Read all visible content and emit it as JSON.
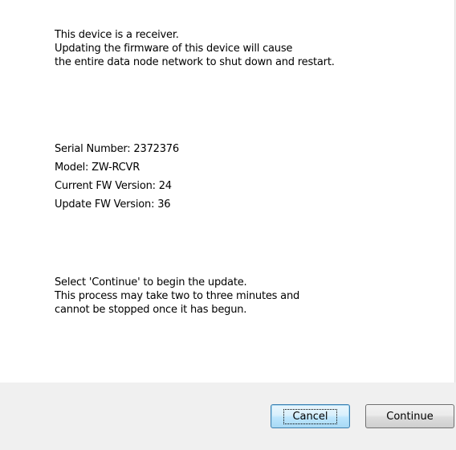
{
  "message": {
    "warning_lines": [
      "This device is a receiver.",
      "Updating the firmware of this device will cause",
      "the entire data node network to shut down and restart."
    ],
    "device_info": [
      "Serial Number: 2372376",
      "Model: ZW-RCVR",
      "Current FW Version: 24",
      "Update FW Version: 36"
    ],
    "instruction_lines": [
      "Select 'Continue' to begin the update.",
      "This process may take two to three minutes and",
      "cannot be stopped once it has begun."
    ]
  },
  "buttons": {
    "cancel_label": "Cancel",
    "continue_label": "Continue"
  },
  "colors": {
    "panel_background": "#ffffff",
    "dialog_background": "#f0f0f0",
    "focused_button_border": "#3c7fb1"
  }
}
